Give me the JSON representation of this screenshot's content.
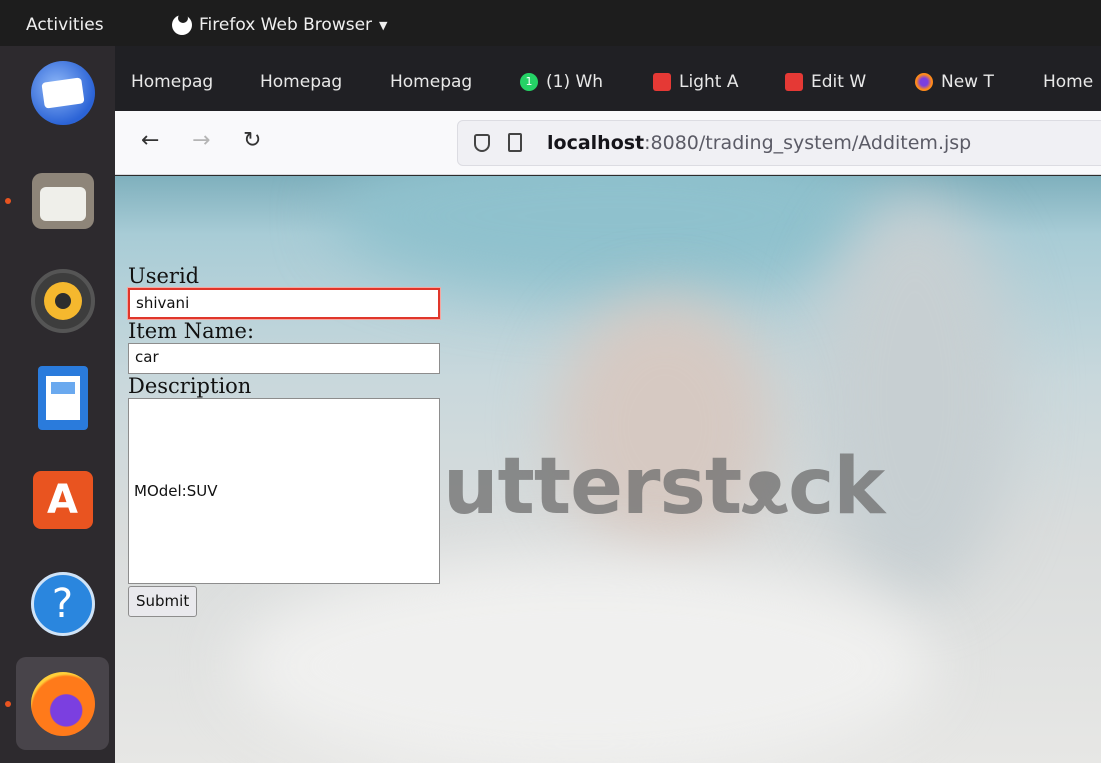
{
  "topbar": {
    "activities": "Activities",
    "app_menu": "Firefox Web Browser"
  },
  "dock": [
    "thunderbird-mail",
    "files",
    "rhythmbox",
    "libreoffice-writer",
    "ubuntu-software",
    "help",
    "firefox"
  ],
  "tabs": [
    {
      "label": "Homepag",
      "icon": "none"
    },
    {
      "label": "Homepag",
      "icon": "none"
    },
    {
      "label": "Homepag",
      "icon": "none"
    },
    {
      "label": "(1) Wh",
      "icon": "whatsapp"
    },
    {
      "label": "Light A",
      "icon": "red-app"
    },
    {
      "label": "Edit W",
      "icon": "red-app"
    },
    {
      "label": "New T",
      "icon": "firefox"
    },
    {
      "label": "Home",
      "icon": "none"
    }
  ],
  "nav": {
    "url_host": "localhost",
    "url_rest": ":8080/trading_system/Additem.jsp"
  },
  "page": {
    "watermark": "utterstᴥck",
    "userid_label": "Userid",
    "userid_value": "shivani",
    "item_label": "Item Name:",
    "item_value": "car",
    "desc_label": "Description",
    "desc_value": "MOdel:SUV",
    "submit": "Submit"
  },
  "colors": {
    "accent": "#e95420",
    "focus_border": "#e0362a"
  }
}
